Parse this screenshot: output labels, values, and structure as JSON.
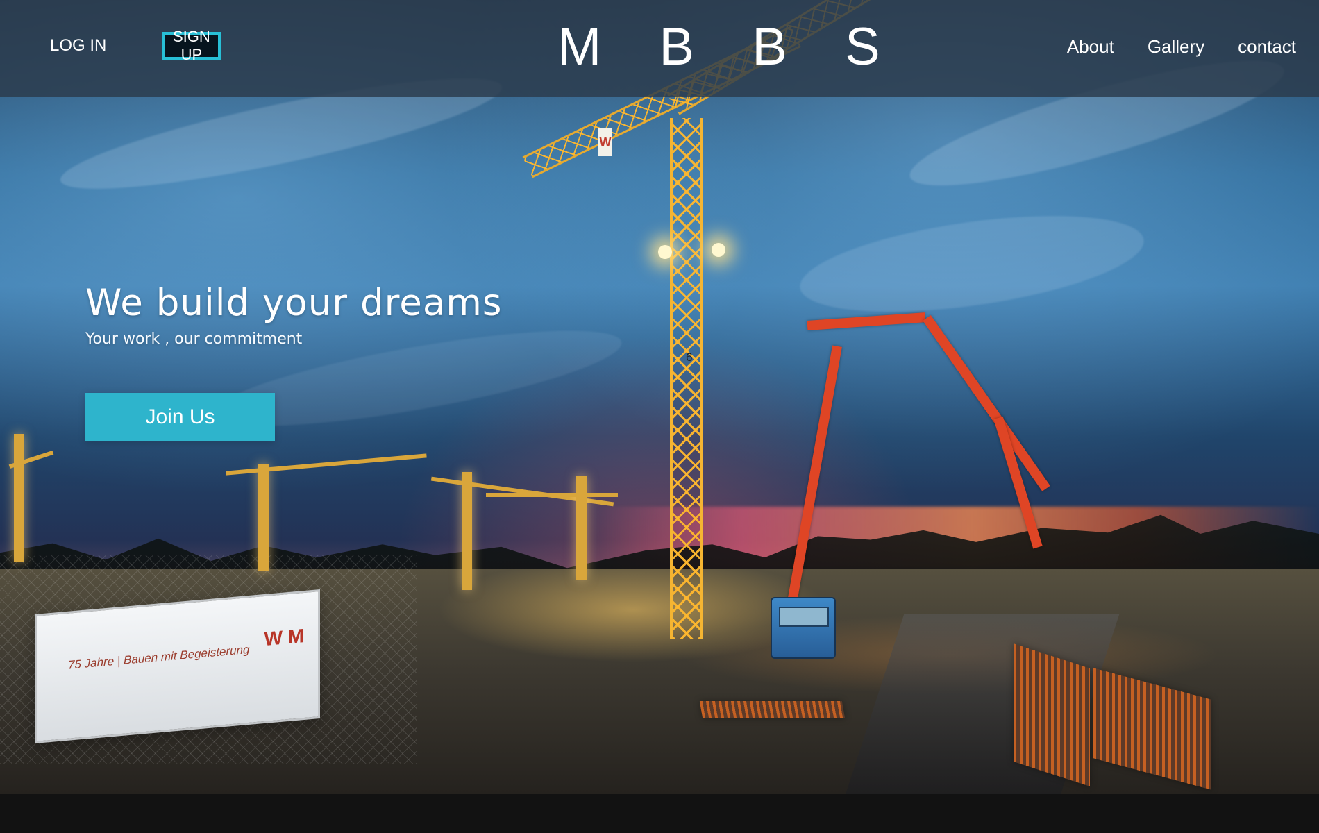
{
  "nav": {
    "login_label": "LOG IN",
    "signup_label": "SIGN UP",
    "brand": "M B B S",
    "right_links": [
      "About",
      "Gallery",
      "contact"
    ]
  },
  "hero": {
    "title": "We build your dreams",
    "subtitle": "Your work , our commitment",
    "cta_label": "Join Us"
  },
  "background_scene": {
    "crane_marker": "W",
    "banner_text": "75 Jahre  |  Bauen mit Begeisterung",
    "banner_logo": "W\nM",
    "crane_number": "6"
  },
  "colors": {
    "accent": "#2eb4cc",
    "navbar": "#2b3b4c",
    "footer": "#121212"
  }
}
